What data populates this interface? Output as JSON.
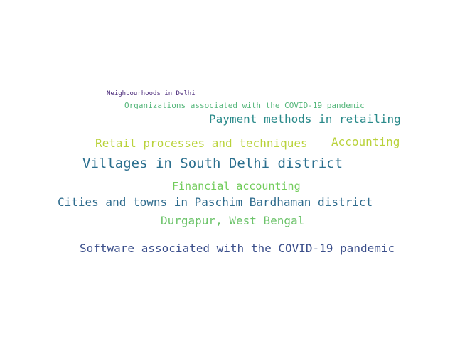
{
  "words": [
    {
      "text": "Neighbourhoods in Delhi",
      "color": "#4b2a7a"
    },
    {
      "text": "Organizations associated with the COVID-19 pandemic",
      "color": "#54b67a"
    },
    {
      "text": "Payment methods in retailing",
      "color": "#2a8a8a"
    },
    {
      "text": "Retail processes and techniques",
      "color": "#b9d23a"
    },
    {
      "text": "Accounting",
      "color": "#b9d23a"
    },
    {
      "text": "Villages in South Delhi district",
      "color": "#2b6f8e"
    },
    {
      "text": "Financial accounting",
      "color": "#72cc5c"
    },
    {
      "text": "Cities and towns in Paschim Bardhaman district",
      "color": "#2e6b8d"
    },
    {
      "text": "Durgapur, West Bengal",
      "color": "#6cc36a"
    },
    {
      "text": "Software associated with the COVID-19 pandemic",
      "color": "#3b4f8b"
    }
  ]
}
